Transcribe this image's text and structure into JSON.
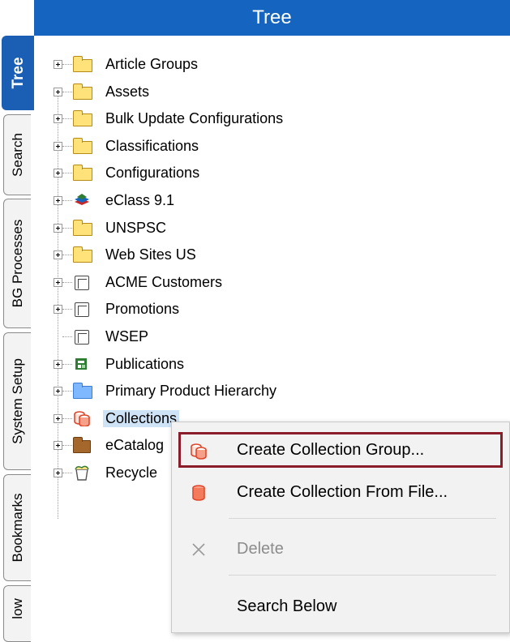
{
  "vertical_tabs": [
    {
      "label": "Tree",
      "active": true
    },
    {
      "label": "Search"
    },
    {
      "label": "BG Processes"
    },
    {
      "label": "System Setup"
    },
    {
      "label": "Bookmarks"
    },
    {
      "label": "low"
    }
  ],
  "panel": {
    "title": "Tree"
  },
  "tree": {
    "nodes": [
      {
        "label": "Article Groups",
        "icon": "folder-icon"
      },
      {
        "label": "Assets",
        "icon": "folder-icon"
      },
      {
        "label": "Bulk Update Configurations",
        "icon": "folder-icon"
      },
      {
        "label": "Classifications",
        "icon": "folder-icon"
      },
      {
        "label": "Configurations",
        "icon": "folder-icon"
      },
      {
        "label": "eClass 9.1",
        "icon": "eclass-icon"
      },
      {
        "label": "UNSPSC",
        "icon": "folder-icon"
      },
      {
        "label": "Web Sites US",
        "icon": "folder-icon"
      },
      {
        "label": "ACME Customers",
        "icon": "cube-icon"
      },
      {
        "label": "Promotions",
        "icon": "cube-icon"
      },
      {
        "label": "WSEP",
        "icon": "cube-icon"
      },
      {
        "label": "Publications",
        "icon": "publication-icon"
      },
      {
        "label": "Primary Product Hierarchy",
        "icon": "blue-folder-icon"
      },
      {
        "label": "Collections",
        "icon": "collection-icon",
        "selected": true
      },
      {
        "label": "eCatalog",
        "icon": "brown-folder-icon"
      },
      {
        "label": "Recycle",
        "icon": "recycle-bin-icon"
      }
    ]
  },
  "context_menu": {
    "items": [
      {
        "label": "Create Collection Group...",
        "icon": "collection-group-icon"
      },
      {
        "label": "Create Collection From File...",
        "icon": "collection-icon"
      },
      {
        "label": "Delete",
        "icon": "delete-icon",
        "disabled": true
      },
      {
        "label": "Search Below"
      }
    ]
  },
  "colors": {
    "accent": "#1565c0",
    "highlight_border": "#8b1c2a",
    "selection": "#cfe3f7"
  }
}
